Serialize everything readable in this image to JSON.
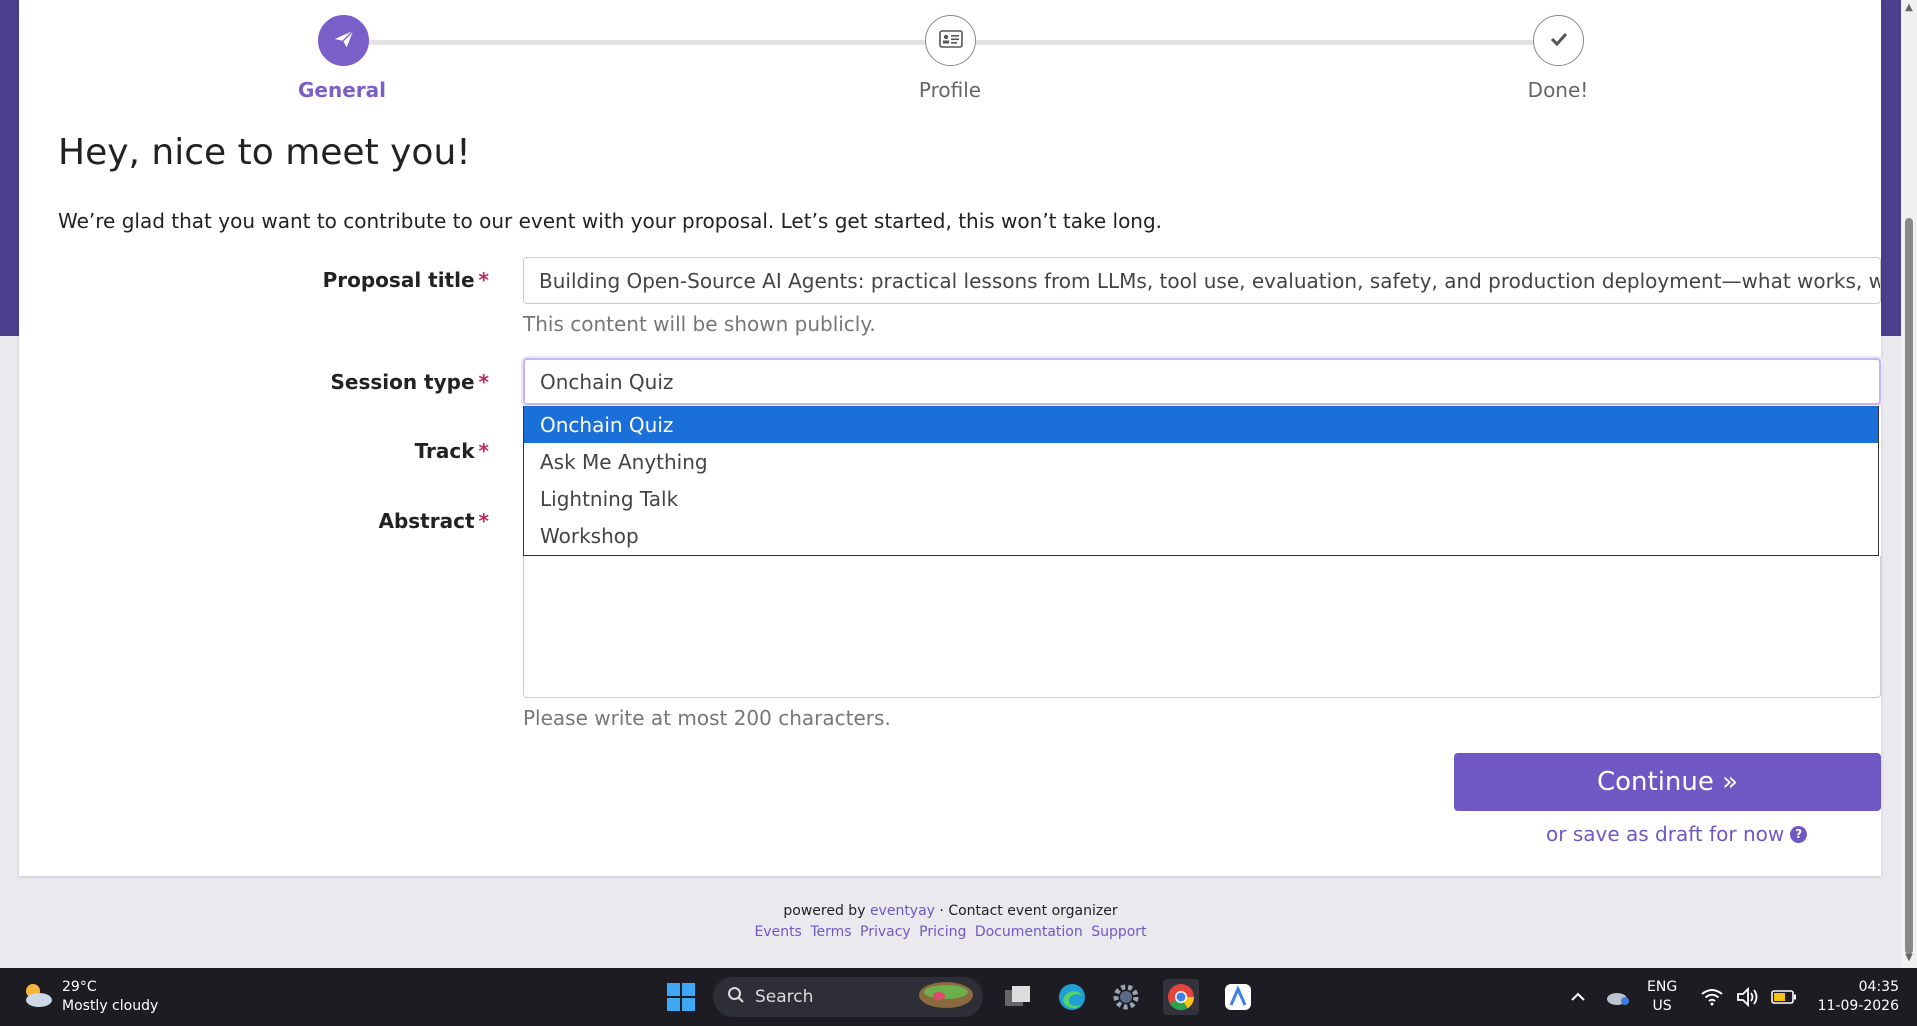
{
  "stepper": {
    "steps": [
      {
        "label": "General",
        "icon": "paper-plane-icon",
        "active": true
      },
      {
        "label": "Profile",
        "icon": "id-card-icon",
        "active": false
      },
      {
        "label": "Done!",
        "icon": "check-icon",
        "active": false
      }
    ]
  },
  "page": {
    "title": "Hey, nice to meet you!",
    "intro": "We’re glad that you want to contribute to our event with your proposal. Let’s get started, this won’t take long."
  },
  "form": {
    "proposal_title": {
      "label": "Proposal title",
      "required": "*",
      "value": "Building Open-Source AI Agents: practical lessons from LLMs, tool use, evaluation, safety, and production deployment—what works, what breaks",
      "help": "This content will be shown publicly."
    },
    "session_type": {
      "label": "Session type",
      "required": "*",
      "value": "Onchain Quiz",
      "options": [
        "Onchain Quiz",
        "Ask Me Anything",
        "Lightning Talk",
        "Workshop"
      ],
      "selected_index": 0
    },
    "track": {
      "label": "Track",
      "required": "*"
    },
    "abstract": {
      "label": "Abstract",
      "required": "*",
      "help": "Please write at most 200 characters."
    },
    "continue_label": "Continue »",
    "draft_label": "or save as draft for now"
  },
  "footer": {
    "powered_by": "powered by",
    "brand": "eventyay",
    "contact": "· Contact event organizer",
    "links": [
      "Events",
      "Terms",
      "Privacy",
      "Pricing",
      "Documentation",
      "Support"
    ]
  },
  "taskbar": {
    "weather_temp": "29°C",
    "weather_desc": "Mostly cloudy",
    "search_label": "Search",
    "lang_line1": "ENG",
    "lang_line2": "US",
    "time": "04:35",
    "date": "11-09-2026"
  },
  "colors": {
    "accent": "#7058c4",
    "header_band": "#4b3f8e",
    "dropdown_selected": "#1a6fd8",
    "required": "#c0295a"
  }
}
